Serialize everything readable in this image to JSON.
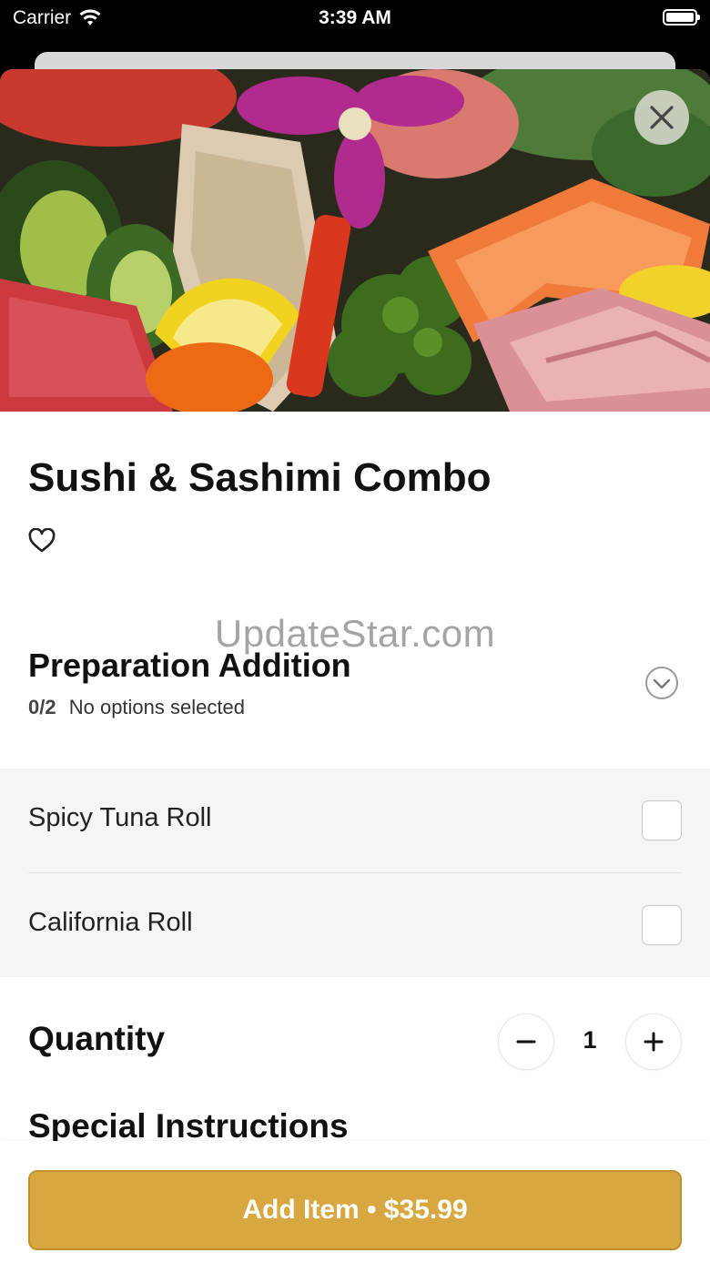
{
  "status_bar": {
    "carrier": "Carrier",
    "time": "3:39 AM"
  },
  "item": {
    "title": "Sushi & Sashimi Combo",
    "image_alt": "sushi-sashimi-platter"
  },
  "watermark": "UpdateStar.com",
  "preparation": {
    "title": "Preparation Addition",
    "count": "0/2",
    "status": "No options selected",
    "options": [
      {
        "label": "Spicy Tuna Roll",
        "checked": false
      },
      {
        "label": "California Roll",
        "checked": false
      }
    ]
  },
  "quantity": {
    "label": "Quantity",
    "value": "1"
  },
  "special_instructions": {
    "title": "Special Instructions"
  },
  "footer": {
    "add_button": "Add Item • $35.99"
  },
  "colors": {
    "accent": "#d9a740",
    "accent_border": "#c08f2c",
    "option_bg": "#f5f5f5"
  },
  "icons": [
    "wifi-icon",
    "battery-icon",
    "close-icon",
    "heart-icon",
    "chevron-down-icon",
    "minus-icon",
    "plus-icon"
  ]
}
